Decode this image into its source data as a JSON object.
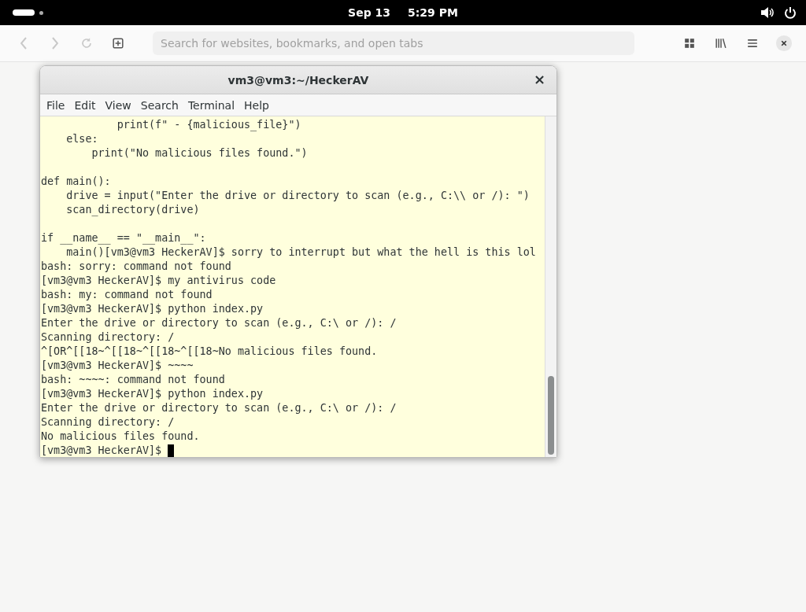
{
  "top_bar": {
    "date": "Sep 13",
    "time": "5:29 PM"
  },
  "browser_toolbar": {
    "nav_buttons": [
      {
        "kind": "back",
        "disabled": true
      },
      {
        "kind": "forward",
        "disabled": true
      },
      {
        "kind": "reload",
        "disabled": true
      },
      {
        "kind": "new-tab",
        "disabled": false
      }
    ],
    "search": {
      "placeholder": "Search for websites, bookmarks, and open tabs"
    },
    "right_buttons": [
      {
        "kind": "tabs-overview"
      },
      {
        "kind": "library"
      },
      {
        "kind": "menu"
      },
      {
        "kind": "close"
      }
    ]
  },
  "terminal": {
    "title": "vm3@vm3:~/HeckerAV",
    "close": "×",
    "menu": [
      "File",
      "Edit",
      "View",
      "Search",
      "Terminal",
      "Help"
    ],
    "lines": [
      {
        "kind": "text",
        "text": "            print(f\" - {malicious_file}\")"
      },
      {
        "kind": "text",
        "text": "    else:"
      },
      {
        "kind": "text",
        "text": "        print(\"No malicious files found.\")"
      },
      {
        "kind": "blank"
      },
      {
        "kind": "text",
        "text": "def main():"
      },
      {
        "kind": "text",
        "text": "    drive = input(\"Enter the drive or directory to scan (e.g., C:\\\\ or /): \")"
      },
      {
        "kind": "text",
        "text": "    scan_directory(drive)"
      },
      {
        "kind": "blank"
      },
      {
        "kind": "text",
        "text": "if __name__ == \"__main__\":"
      },
      {
        "kind": "text",
        "text": "    main()[vm3@vm3 HeckerAV]$ sorry to interrupt but what the hell is this lol"
      },
      {
        "kind": "text",
        "text": "bash: sorry: command not found"
      },
      {
        "kind": "text",
        "text": "[vm3@vm3 HeckerAV]$ my antivirus code"
      },
      {
        "kind": "text",
        "text": "bash: my: command not found"
      },
      {
        "kind": "text",
        "text": "[vm3@vm3 HeckerAV]$ python index.py"
      },
      {
        "kind": "text",
        "text": "Enter the drive or directory to scan (e.g., C:\\ or /): /"
      },
      {
        "kind": "text",
        "text": "Scanning directory: /"
      },
      {
        "kind": "text",
        "text": "^[OR^[[18~^[[18~^[[18~^[[18~No malicious files found."
      },
      {
        "kind": "text",
        "text": "[vm3@vm3 HeckerAV]$ ~~~~"
      },
      {
        "kind": "text",
        "text": "bash: ~~~~: command not found"
      },
      {
        "kind": "text",
        "text": "[vm3@vm3 HeckerAV]$ python index.py"
      },
      {
        "kind": "text",
        "text": "Enter the drive or directory to scan (e.g., C:\\ or /): /"
      },
      {
        "kind": "text",
        "text": "Scanning directory: /"
      },
      {
        "kind": "text",
        "text": "No malicious files found."
      },
      {
        "kind": "prompt",
        "text": "[vm3@vm3 HeckerAV]$"
      }
    ]
  }
}
